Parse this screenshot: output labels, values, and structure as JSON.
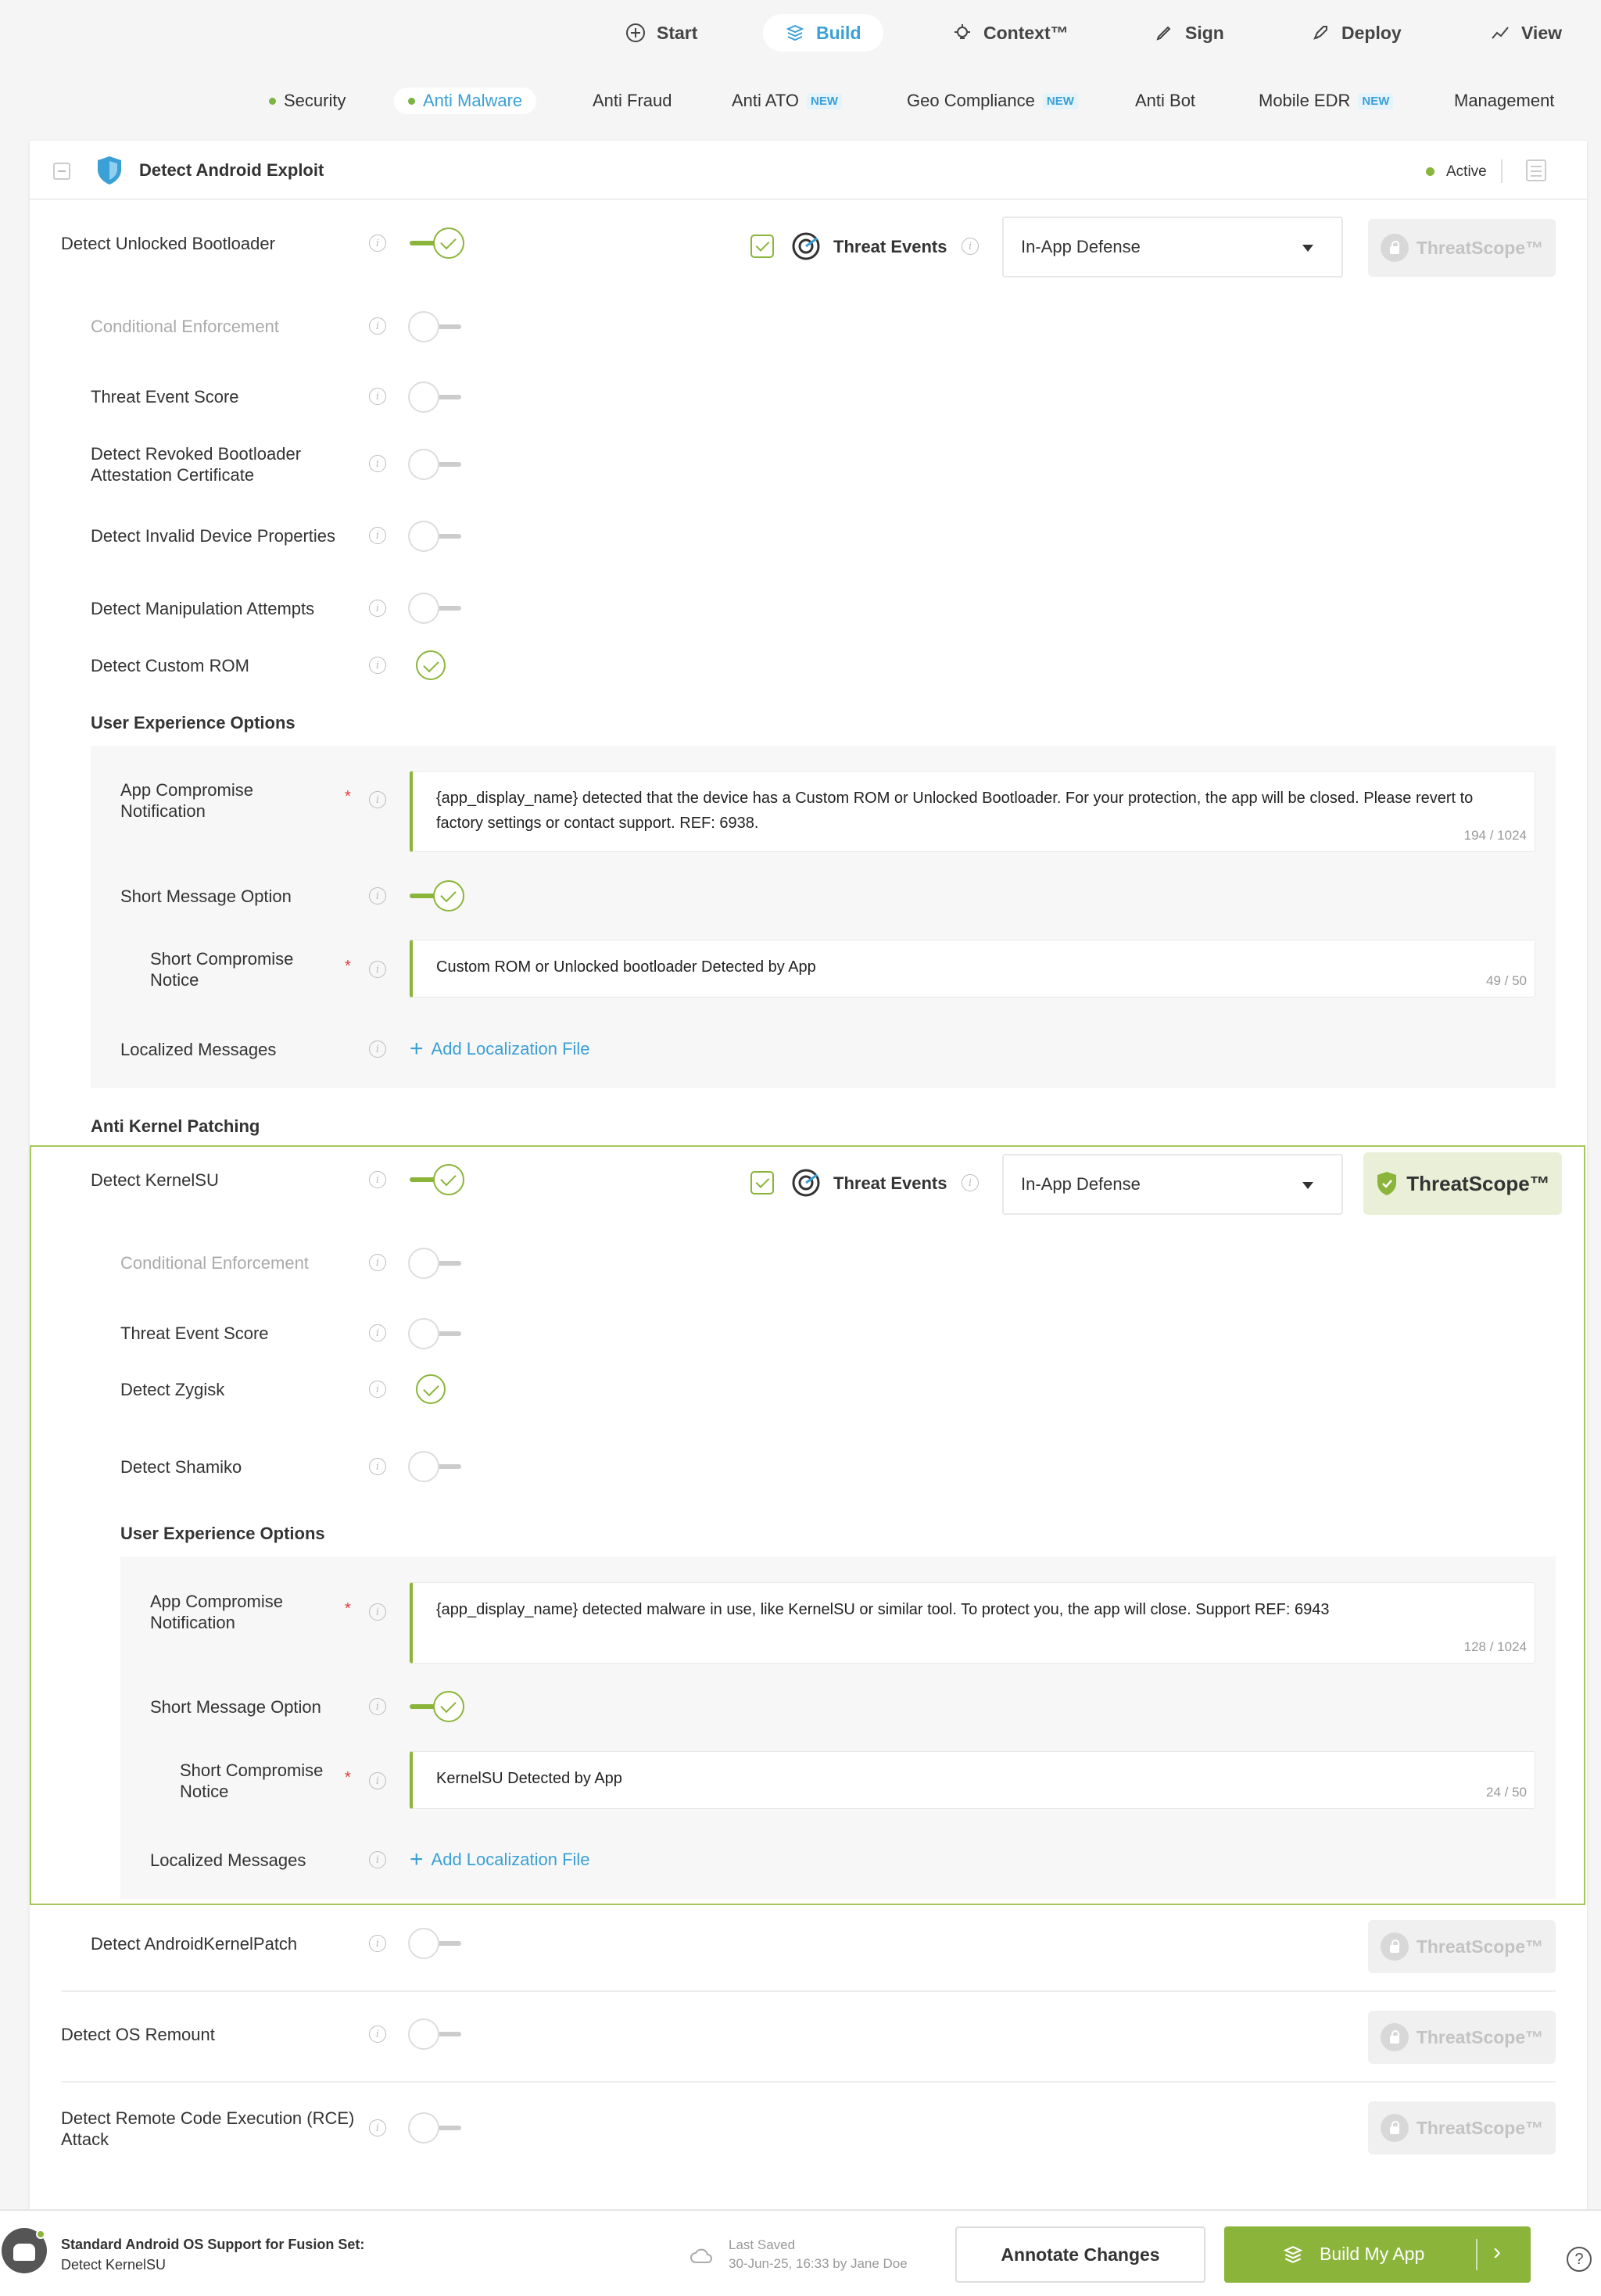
{
  "topnav": {
    "items": [
      {
        "label": "Start",
        "icon": "plus-circle-icon"
      },
      {
        "label": "Build",
        "icon": "build-icon"
      },
      {
        "label": "Context™",
        "icon": "bulb-icon"
      },
      {
        "label": "Sign",
        "icon": "pen-icon"
      },
      {
        "label": "Deploy",
        "icon": "rocket-icon"
      },
      {
        "label": "View",
        "icon": "chart-icon"
      }
    ],
    "active": "Build"
  },
  "subnav": {
    "items": [
      {
        "label": "Security"
      },
      {
        "label": "Anti Malware"
      },
      {
        "label": "Anti Fraud"
      },
      {
        "label": "Anti ATO",
        "badge": "NEW"
      },
      {
        "label": "Geo Compliance",
        "badge": "NEW"
      },
      {
        "label": "Anti Bot"
      },
      {
        "label": "Mobile EDR",
        "badge": "NEW"
      },
      {
        "label": "Management"
      }
    ],
    "active": "Anti Malware"
  },
  "card": {
    "title": "Detect Android Exploit",
    "status": "Active"
  },
  "bootloader": {
    "label": "Detect Unlocked Bootloader",
    "threat_events": "Threat Events",
    "select_value": "In-App Defense",
    "threatscope": "ThreatScope™",
    "conditional": "Conditional Enforcement",
    "score": "Threat Event Score",
    "revoked": "Detect Revoked Bootloader Attestation Certificate",
    "invalid": "Detect Invalid Device Properties",
    "manip": "Detect Manipulation Attempts",
    "customrom": "Detect Custom ROM",
    "ux_title": "User Experience Options",
    "notif_label": "App Compromise Notification",
    "notif_text": "{app_display_name} detected that the device has a Custom ROM or Unlocked Bootloader. For your protection, the app will be closed. Please revert to factory settings or contact support. REF: 6938.",
    "notif_count": "194 / 1024",
    "short_label": "Short Message Option",
    "short_notice_label": "Short Compromise Notice",
    "short_text": "Custom ROM or Unlocked bootloader Detected by App",
    "short_count": "49 / 50",
    "loc_label": "Localized Messages",
    "add_loc": "Add Localization File"
  },
  "kernel": {
    "section_title": "Anti Kernel Patching",
    "label": "Detect KernelSU",
    "threat_events": "Threat Events",
    "select_value": "In-App Defense",
    "threatscope": "ThreatScope™",
    "conditional": "Conditional Enforcement",
    "score": "Threat Event Score",
    "zygisk": "Detect Zygisk",
    "shamiko": "Detect Shamiko",
    "ux_title": "User Experience Options",
    "notif_label": "App Compromise Notification",
    "notif_text": "{app_display_name} detected malware in use, like KernelSU or similar tool. To protect you, the app will close. Support REF: 6943",
    "notif_count": "128 / 1024",
    "short_label": "Short Message Option",
    "short_notice_label": "Short Compromise Notice",
    "short_text": "KernelSU Detected by App",
    "short_count": "24 / 50",
    "loc_label": "Localized Messages",
    "add_loc": "Add Localization File"
  },
  "other": [
    {
      "label": "Detect AndroidKernelPatch",
      "threatscope": "ThreatScope™"
    },
    {
      "label": "Detect OS Remount",
      "threatscope": "ThreatScope™"
    },
    {
      "label": "Detect Remote Code Execution (RCE) Attack",
      "threatscope": "ThreatScope™"
    }
  ],
  "bottom": {
    "support_title": "Standard Android OS Support for Fusion Set:",
    "support_sub": "Detect KernelSU",
    "last_saved_label": "Last Saved",
    "last_saved_value": "30-Jun-25, 16:33 by Jane Doe",
    "annotate": "Annotate Changes",
    "build": "Build My App"
  },
  "colors": {
    "accent": "#8bb53a",
    "link": "#3aa0d6"
  }
}
